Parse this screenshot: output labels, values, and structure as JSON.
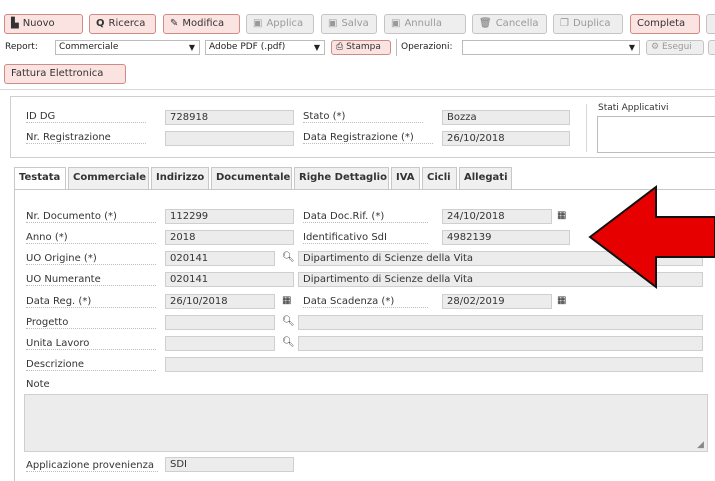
{
  "toolbar": {
    "nuovo": "Nuovo",
    "ricerca": "Ricerca",
    "modifica": "Modifica",
    "applica": "Applica",
    "salva": "Salva",
    "annulla": "Annulla",
    "cancella": "Cancella",
    "duplica": "Duplica",
    "completa": "Completa"
  },
  "report": {
    "label": "Report:",
    "value": "Commerciale",
    "format": "Adobe PDF (.pdf)",
    "print": "Stampa"
  },
  "operations": {
    "label": "Operazioni:",
    "value": "",
    "run": "Esegui"
  },
  "fattura_button": "Fattura Elettronica",
  "header": {
    "id_dg_label": "ID DG",
    "id_dg_value": "728918",
    "stato_label": "Stato (*)",
    "stato_value": "Bozza",
    "nr_reg_label": "Nr. Registrazione",
    "nr_reg_value": "",
    "data_reg_label": "Data Registrazione (*)",
    "data_reg_value": "26/10/2018",
    "stati_label": "Stati Applicativi"
  },
  "tabs": [
    "Testata",
    "Commerciale",
    "Indirizzo",
    "Documentale",
    "Righe Dettaglio",
    "IVA",
    "Cicli",
    "Allegati"
  ],
  "form": {
    "nr_doc_label": "Nr. Documento (*)",
    "nr_doc_value": "112299",
    "data_doc_rif_label": "Data Doc.Rif. (*)",
    "data_doc_rif_value": "24/10/2018",
    "anno_label": "Anno (*)",
    "anno_value": "2018",
    "id_sdi_label": "Identificativo SdI",
    "id_sdi_value": "4982139",
    "uo_origine_label": "UO Origine (*)",
    "uo_origine_code": "020141",
    "uo_origine_desc": "Dipartimento di Scienze della Vita",
    "uo_numerante_label": "UO Numerante",
    "uo_numerante_code": "020141",
    "uo_numerante_desc": "Dipartimento di Scienze della Vita",
    "data_reg_label": "Data Reg. (*)",
    "data_reg_value": "26/10/2018",
    "data_scad_label": "Data Scadenza (*)",
    "data_scad_value": "28/02/2019",
    "progetto_label": "Progetto",
    "unita_lavoro_label": "Unita Lavoro",
    "descrizione_label": "Descrizione",
    "note_label": "Note",
    "app_prov_label": "Applicazione provenienza",
    "app_prov_value": "SDI"
  },
  "colors": {
    "accent_red": "#e60000",
    "button_red_bg": "#fbe3e1",
    "field_bg": "#ececec"
  }
}
